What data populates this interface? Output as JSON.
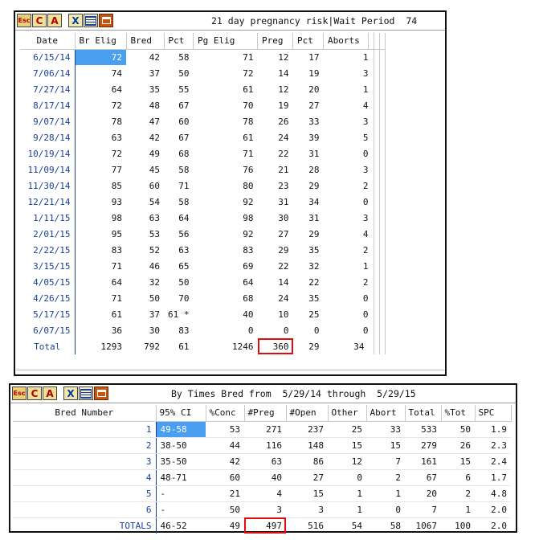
{
  "toolbar": {
    "icons": [
      "esc-icon",
      "c-icon",
      "a-icon",
      "x-icon",
      "grid-icon",
      "window-icon"
    ],
    "esc": "Esc",
    "c": "C",
    "a": "A",
    "x": "X"
  },
  "panel1": {
    "title": "21 day pregnancy risk|Wait Period  74",
    "columns": [
      "Date",
      "Br Elig",
      "Bred",
      "Pct",
      "Pg Elig",
      "Preg",
      "Pct",
      "Aborts"
    ],
    "rows": [
      [
        "6/15/14",
        "72",
        "42",
        "58",
        "71",
        "12",
        "17",
        "1"
      ],
      [
        "7/06/14",
        "74",
        "37",
        "50",
        "72",
        "14",
        "19",
        "3"
      ],
      [
        "7/27/14",
        "64",
        "35",
        "55",
        "61",
        "12",
        "20",
        "1"
      ],
      [
        "8/17/14",
        "72",
        "48",
        "67",
        "70",
        "19",
        "27",
        "4"
      ],
      [
        "9/07/14",
        "78",
        "47",
        "60",
        "78",
        "26",
        "33",
        "3"
      ],
      [
        "9/28/14",
        "63",
        "42",
        "67",
        "61",
        "24",
        "39",
        "5"
      ],
      [
        "10/19/14",
        "72",
        "49",
        "68",
        "71",
        "22",
        "31",
        "0"
      ],
      [
        "11/09/14",
        "77",
        "45",
        "58",
        "76",
        "21",
        "28",
        "3"
      ],
      [
        "11/30/14",
        "85",
        "60",
        "71",
        "80",
        "23",
        "29",
        "2"
      ],
      [
        "12/21/14",
        "93",
        "54",
        "58",
        "92",
        "31",
        "34",
        "0"
      ],
      [
        "1/11/15",
        "98",
        "63",
        "64",
        "98",
        "30",
        "31",
        "3"
      ],
      [
        "2/01/15",
        "95",
        "53",
        "56",
        "92",
        "27",
        "29",
        "4"
      ],
      [
        "2/22/15",
        "83",
        "52",
        "63",
        "83",
        "29",
        "35",
        "2"
      ],
      [
        "3/15/15",
        "71",
        "46",
        "65",
        "69",
        "22",
        "32",
        "1"
      ],
      [
        "4/05/15",
        "64",
        "32",
        "50",
        "64",
        "14",
        "22",
        "2"
      ],
      [
        "4/26/15",
        "71",
        "50",
        "70",
        "68",
        "24",
        "35",
        "0"
      ],
      [
        "5/17/15",
        "61",
        "37",
        "61 *",
        "40",
        "10",
        "25",
        "0"
      ],
      [
        "6/07/15",
        "36",
        "30",
        "83",
        "0",
        "0",
        "0",
        "0"
      ]
    ],
    "total": [
      "Total",
      "1293",
      "792",
      "61",
      "1246",
      "360",
      "29",
      "34"
    ]
  },
  "panel2": {
    "title": "By Times Bred from  5/29/14 through  5/29/15",
    "columns": [
      "Bred Number",
      "95% CI",
      "%Conc",
      "#Preg",
      "#Open",
      "Other",
      "Abort",
      "Total",
      "%Tot",
      "SPC"
    ],
    "rows": [
      [
        "1",
        "49-58",
        "53",
        "271",
        "237",
        "25",
        "33",
        "533",
        "50",
        "1.9"
      ],
      [
        "2",
        "38-50",
        "44",
        "116",
        "148",
        "15",
        "15",
        "279",
        "26",
        "2.3"
      ],
      [
        "3",
        "35-50",
        "42",
        "63",
        "86",
        "12",
        "7",
        "161",
        "15",
        "2.4"
      ],
      [
        "4",
        "48-71",
        "60",
        "40",
        "27",
        "0",
        "2",
        "67",
        "6",
        "1.7"
      ],
      [
        "5",
        "-",
        "21",
        "4",
        "15",
        "1",
        "1",
        "20",
        "2",
        "4.8"
      ],
      [
        "6",
        "-",
        "50",
        "3",
        "3",
        "1",
        "0",
        "7",
        "1",
        "2.0"
      ]
    ],
    "totals": [
      "TOTALS",
      "46-52",
      "49",
      "497",
      "516",
      "54",
      "58",
      "1067",
      "100",
      "2.0"
    ]
  },
  "colors": {
    "selection": "#4a9ff0",
    "highlight_box": "#e20c0c",
    "link_blue": "#163e9c"
  }
}
